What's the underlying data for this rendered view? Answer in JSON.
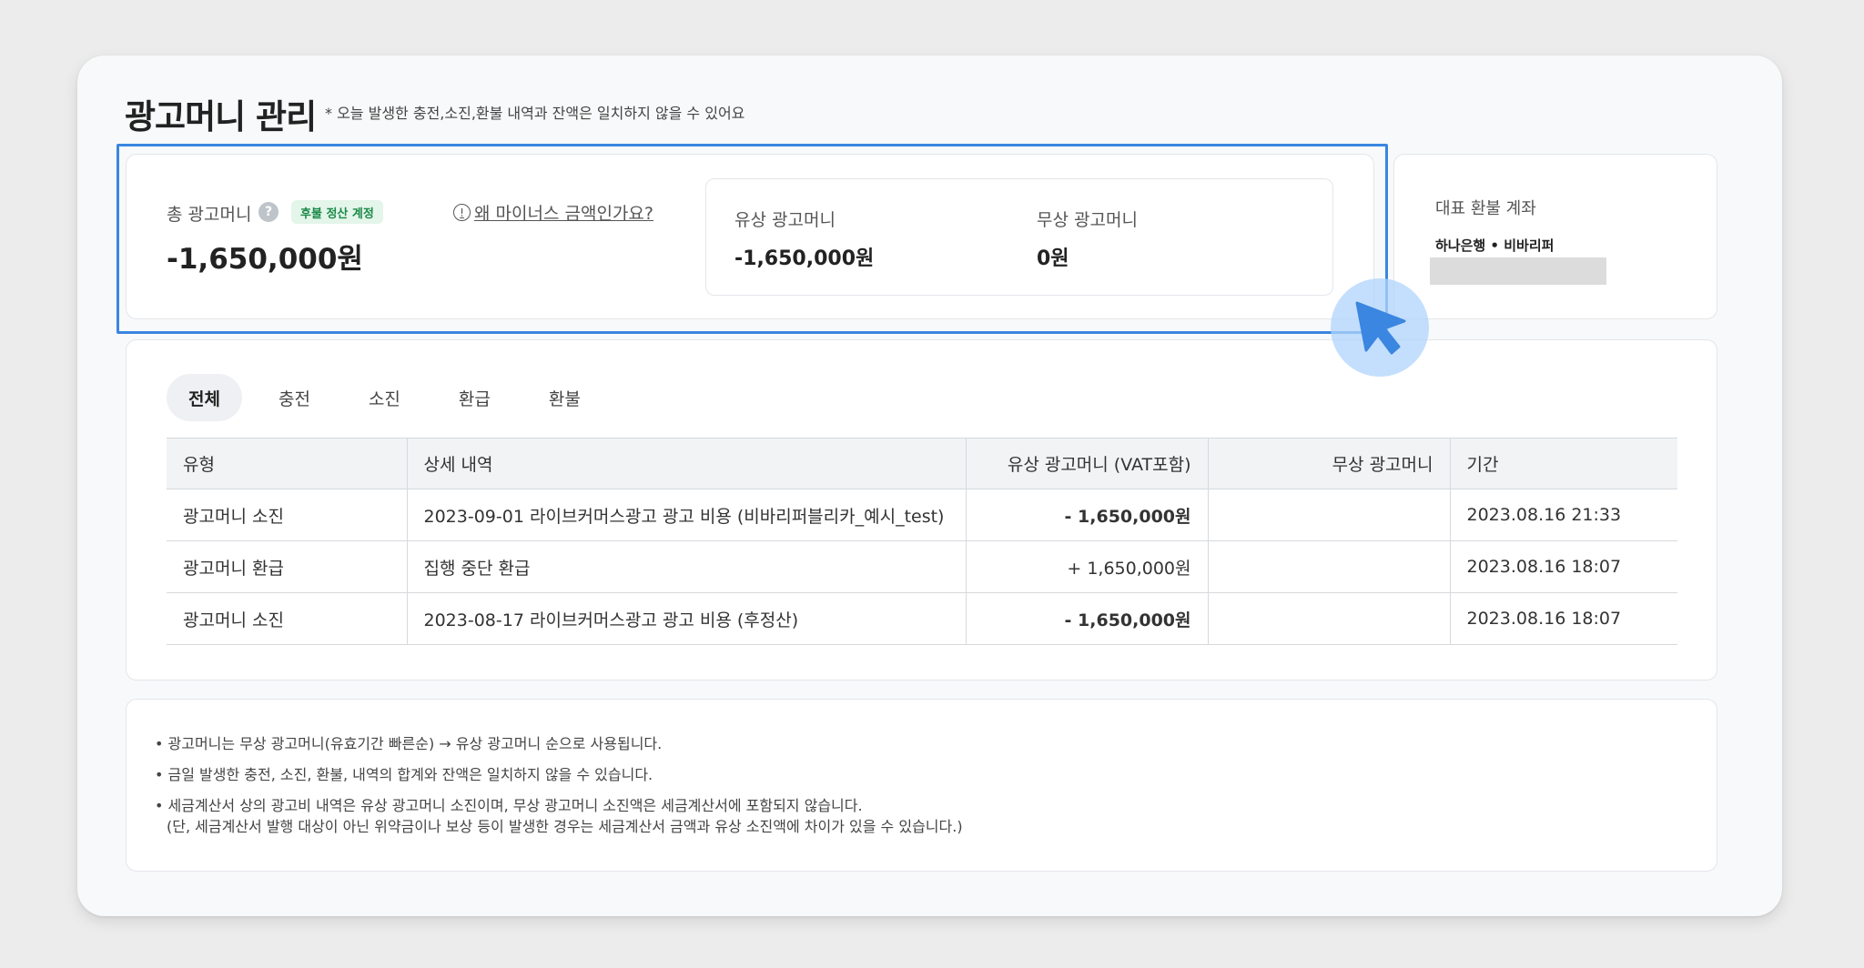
{
  "page": {
    "title": "광고머니 관리",
    "note": "* 오늘 발생한 충전,소진,환불 내역과 잔액은 일치하지 않을 수 있어요"
  },
  "summary": {
    "total_label": "총 광고머니",
    "help_icon": "question-circle-icon",
    "badge": "후불 정산 계정",
    "why_link": "왜 마이너스 금액인가요?",
    "info_icon": "info-circle-icon",
    "total_amount": "-1,650,000원",
    "paid_label": "유상 광고머니",
    "paid_amount": "-1,650,000원",
    "free_label": "무상 광고머니",
    "free_amount": "0원"
  },
  "refund_account": {
    "title": "대표 환불 계좌",
    "bank": "하나은행 • 비바리퍼"
  },
  "tabs": [
    {
      "label": "전체",
      "active": true
    },
    {
      "label": "충전",
      "active": false
    },
    {
      "label": "소진",
      "active": false
    },
    {
      "label": "환급",
      "active": false
    },
    {
      "label": "환불",
      "active": false
    }
  ],
  "table": {
    "headers": [
      "유형",
      "상세 내역",
      "유상 광고머니 (VAT포함)",
      "무상 광고머니",
      "기간"
    ],
    "rows": [
      {
        "type": "광고머니 소진",
        "detail": "2023-09-01 라이브커머스광고 광고 비용 (비바리퍼블리카_예시_test)",
        "paid": "- 1,650,000원",
        "free": "",
        "date": "2023.08.16 21:33"
      },
      {
        "type": "광고머니 환급",
        "detail": "집행 중단 환급",
        "paid": "+ 1,650,000원",
        "free": "",
        "date": "2023.08.16 18:07"
      },
      {
        "type": "광고머니 소진",
        "detail": "2023-08-17 라이브커머스광고 광고 비용 (후정산)",
        "paid": "- 1,650,000원",
        "free": "",
        "date": "2023.08.16 18:07"
      }
    ]
  },
  "notes": [
    "• 광고머니는 무상 광고머니(유효기간 빠른순) → 유상 광고머니 순으로 사용됩니다.",
    "• 금일 발생한 충전, 소진, 환불, 내역의 합계와 잔액은 일치하지 않을 수 있습니다.",
    "• 세금계산서 상의 광고비 내역은 유상 광고머니 소진이며, 무상 광고머니 소진액은 세금계산서에 포함되지 않습니다.",
    "(단, 세금계산서 발행 대상이 아닌 위약금이나 보상 등이 발생한 경우는 세금계산서 금액과 유상 소진액에 차이가 있을 수 있습니다.)"
  ],
  "colors": {
    "highlight": "#3a86e0",
    "positive": "#3a7fd8",
    "badge_bg": "#e4f5ea",
    "badge_text": "#1c8a49"
  },
  "cursor_icon": "mouse-pointer-icon"
}
